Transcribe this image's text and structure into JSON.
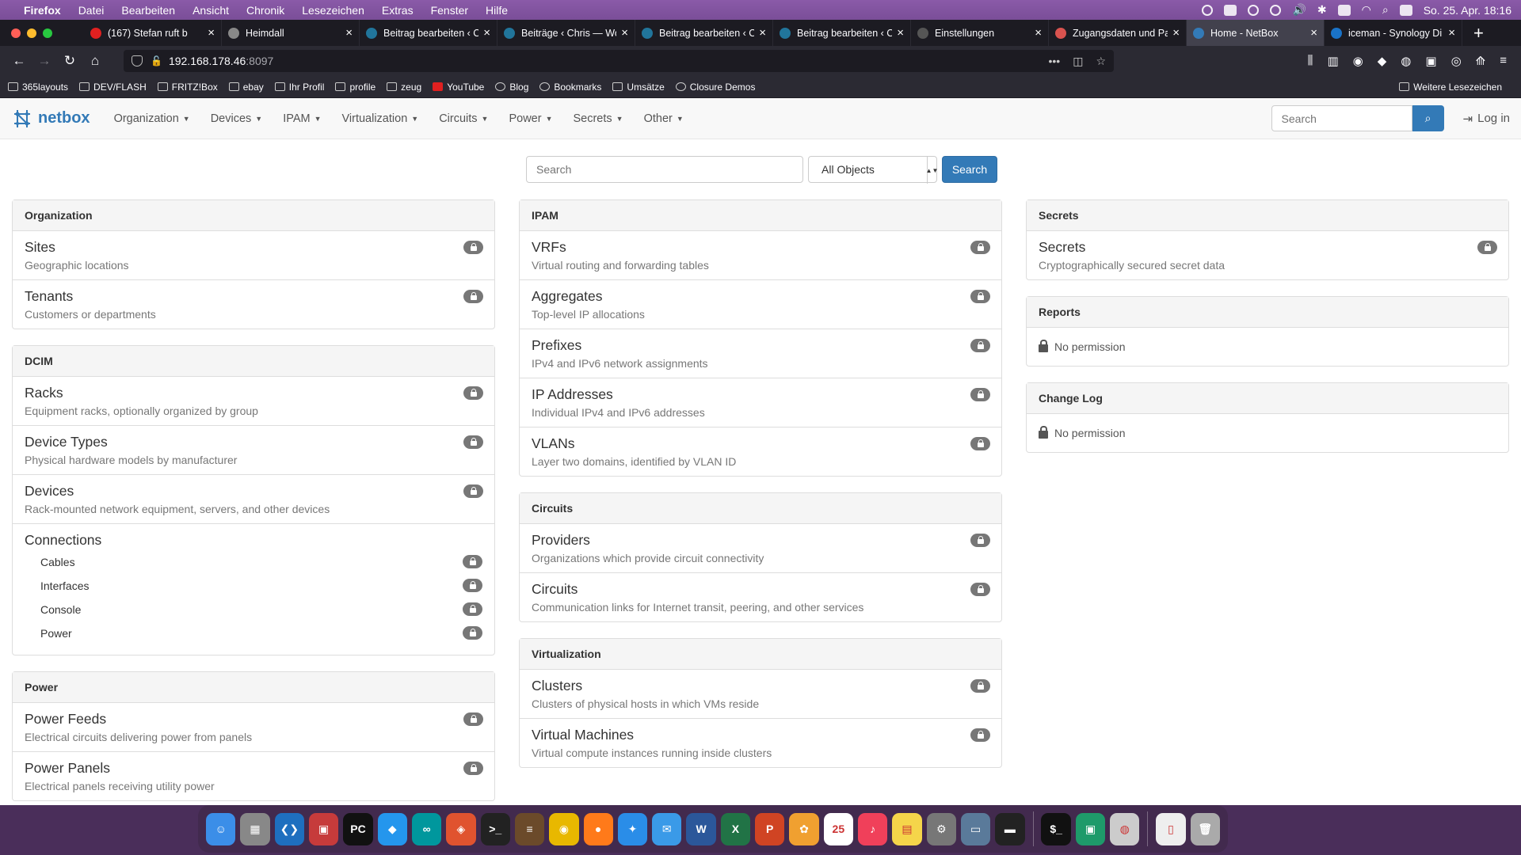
{
  "menubar": {
    "app": "Firefox",
    "items": [
      "Datei",
      "Bearbeiten",
      "Ansicht",
      "Chronik",
      "Lesezeichen",
      "Extras",
      "Fenster",
      "Hilfe"
    ],
    "datetime": "So. 25. Apr.  18:16"
  },
  "tabs": [
    {
      "label": "(167) Stefan ruft b",
      "icon": "youtube-icon",
      "color": "#e02020",
      "active": false
    },
    {
      "label": "Heimdall",
      "icon": "heimdall-icon",
      "color": "#888888",
      "active": false
    },
    {
      "label": "Beitrag bearbeiten ‹ C",
      "icon": "wordpress-icon",
      "color": "#21759b",
      "active": false
    },
    {
      "label": "Beiträge ‹ Chris — Wo",
      "icon": "wordpress-icon",
      "color": "#21759b",
      "active": false
    },
    {
      "label": "Beitrag bearbeiten ‹ C",
      "icon": "wordpress-icon",
      "color": "#21759b",
      "active": false
    },
    {
      "label": "Beitrag bearbeiten ‹ C",
      "icon": "wordpress-icon",
      "color": "#21759b",
      "active": false
    },
    {
      "label": "Einstellungen",
      "icon": "gear-icon",
      "color": "#555555",
      "active": false
    },
    {
      "label": "Zugangsdaten und Pa",
      "icon": "key-icon",
      "color": "#d9534f",
      "active": false
    },
    {
      "label": "Home - NetBox",
      "icon": "netbox-icon",
      "color": "#337ab7",
      "active": true
    },
    {
      "label": "iceman - Synology Di",
      "icon": "synology-icon",
      "color": "#1a73c8",
      "active": false
    }
  ],
  "url": {
    "host": "192.168.178.46",
    "port": ":8097"
  },
  "bookmarks": [
    {
      "label": "365layouts",
      "icon": "folder-icon"
    },
    {
      "label": "DEV/FLASH",
      "icon": "folder-icon"
    },
    {
      "label": "FRITZ!Box",
      "icon": "fritzbox-icon"
    },
    {
      "label": "ebay",
      "icon": "ebay-icon"
    },
    {
      "label": "Ihr Profil",
      "icon": "amazon-icon"
    },
    {
      "label": "profile",
      "icon": "folder-icon"
    },
    {
      "label": "zeug",
      "icon": "folder-icon"
    },
    {
      "label": "YouTube",
      "icon": "youtube-icon"
    },
    {
      "label": "Blog",
      "icon": "globe-icon"
    },
    {
      "label": "Bookmarks",
      "icon": "bookmarks-icon"
    },
    {
      "label": "Umsätze",
      "icon": "bank-icon"
    },
    {
      "label": "Closure Demos",
      "icon": "globe-icon"
    }
  ],
  "bookmarks_more": "Weitere Lesezeichen",
  "netbox": {
    "logo": "netbox",
    "menu": [
      "Organization",
      "Devices",
      "IPAM",
      "Virtualization",
      "Circuits",
      "Power",
      "Secrets",
      "Other"
    ],
    "search_placeholder": "Search",
    "login": "Log in"
  },
  "search": {
    "placeholder": "Search",
    "scope": "All Objects",
    "button": "Search"
  },
  "columns": {
    "left": [
      {
        "heading": "Organization",
        "items": [
          {
            "title": "Sites",
            "desc": "Geographic locations"
          },
          {
            "title": "Tenants",
            "desc": "Customers or departments"
          }
        ]
      },
      {
        "heading": "DCIM",
        "items": [
          {
            "title": "Racks",
            "desc": "Equipment racks, optionally organized by group"
          },
          {
            "title": "Device Types",
            "desc": "Physical hardware models by manufacturer"
          },
          {
            "title": "Devices",
            "desc": "Rack-mounted network equipment, servers, and other devices"
          }
        ],
        "connections": {
          "title": "Connections",
          "subs": [
            "Cables",
            "Interfaces",
            "Console",
            "Power"
          ]
        }
      },
      {
        "heading": "Power",
        "items": [
          {
            "title": "Power Feeds",
            "desc": "Electrical circuits delivering power from panels"
          },
          {
            "title": "Power Panels",
            "desc": "Electrical panels receiving utility power"
          }
        ]
      }
    ],
    "middle": [
      {
        "heading": "IPAM",
        "items": [
          {
            "title": "VRFs",
            "desc": "Virtual routing and forwarding tables"
          },
          {
            "title": "Aggregates",
            "desc": "Top-level IP allocations"
          },
          {
            "title": "Prefixes",
            "desc": "IPv4 and IPv6 network assignments"
          },
          {
            "title": "IP Addresses",
            "desc": "Individual IPv4 and IPv6 addresses"
          },
          {
            "title": "VLANs",
            "desc": "Layer two domains, identified by VLAN ID"
          }
        ]
      },
      {
        "heading": "Circuits",
        "items": [
          {
            "title": "Providers",
            "desc": "Organizations which provide circuit connectivity"
          },
          {
            "title": "Circuits",
            "desc": "Communication links for Internet transit, peering, and other services"
          }
        ]
      },
      {
        "heading": "Virtualization",
        "items": [
          {
            "title": "Clusters",
            "desc": "Clusters of physical hosts in which VMs reside"
          },
          {
            "title": "Virtual Machines",
            "desc": "Virtual compute instances running inside clusters"
          }
        ]
      }
    ],
    "right": {
      "secrets": {
        "heading": "Secrets",
        "items": [
          {
            "title": "Secrets",
            "desc": "Cryptographically secured secret data"
          }
        ]
      },
      "reports": {
        "heading": "Reports",
        "text": "No permission"
      },
      "changelog": {
        "heading": "Change Log",
        "text": "No permission"
      }
    }
  },
  "dock": [
    {
      "name": "finder-icon",
      "color": "#3b8ee8",
      "glyph": "☺"
    },
    {
      "name": "launchpad-icon",
      "color": "#888888",
      "glyph": "▦"
    },
    {
      "name": "vscode-icon",
      "color": "#1e6fbf",
      "glyph": "❮❯"
    },
    {
      "name": "remote-desktop-icon",
      "color": "#c63b3b",
      "glyph": "▣"
    },
    {
      "name": "pycharm-icon",
      "color": "#111111",
      "glyph": "PC"
    },
    {
      "name": "docker-icon",
      "color": "#2496ed",
      "glyph": "◆"
    },
    {
      "name": "arduino-icon",
      "color": "#00979d",
      "glyph": "∞"
    },
    {
      "name": "git-icon",
      "color": "#e0532f",
      "glyph": "◈"
    },
    {
      "name": "terminal-icon",
      "color": "#222222",
      "glyph": ">_"
    },
    {
      "name": "books-icon",
      "color": "#6b4a2a",
      "glyph": "≡"
    },
    {
      "name": "chrome-icon",
      "color": "#e8b800",
      "glyph": "◉"
    },
    {
      "name": "firefox-icon",
      "color": "#ff7a1a",
      "glyph": "●"
    },
    {
      "name": "safari-icon",
      "color": "#2a8de8",
      "glyph": "✦"
    },
    {
      "name": "mail-icon",
      "color": "#3a9ae8",
      "glyph": "✉"
    },
    {
      "name": "word-icon",
      "color": "#2b579a",
      "glyph": "W"
    },
    {
      "name": "excel-icon",
      "color": "#217346",
      "glyph": "X"
    },
    {
      "name": "powerpoint-icon",
      "color": "#d04423",
      "glyph": "P"
    },
    {
      "name": "photos-icon",
      "color": "#f0a030",
      "glyph": "✿"
    },
    {
      "name": "calendar-icon",
      "color": "#ffffff",
      "glyph": "25"
    },
    {
      "name": "music-icon",
      "color": "#f0405a",
      "glyph": "♪"
    },
    {
      "name": "notes-icon",
      "color": "#f5d54a",
      "glyph": "▤"
    },
    {
      "name": "system-preferences-icon",
      "color": "#777777",
      "glyph": "⚙"
    },
    {
      "name": "preview-icon",
      "color": "#5a7a9a",
      "glyph": "▭"
    },
    {
      "name": "console-icon",
      "color": "#222222",
      "glyph": "▬"
    },
    {
      "name": "iterm-icon",
      "color": "#111111",
      "glyph": "$_"
    },
    {
      "name": "remote-icon",
      "color": "#1e9a6a",
      "glyph": "▣"
    },
    {
      "name": "system-info-icon",
      "color": "#cccccc",
      "glyph": "◍"
    },
    {
      "name": "documents-icon",
      "color": "#eeeeee",
      "glyph": "▯"
    },
    {
      "name": "trash-icon",
      "color": "#aaaaaa",
      "glyph": "🗑"
    }
  ]
}
